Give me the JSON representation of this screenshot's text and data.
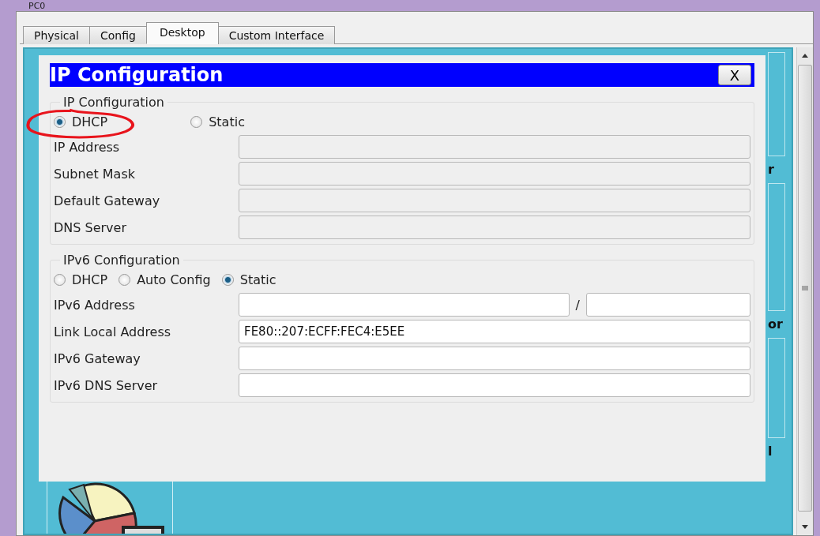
{
  "window": {
    "title": "PC0"
  },
  "tabs": [
    {
      "label": "Physical",
      "selected": false
    },
    {
      "label": "Config",
      "selected": false
    },
    {
      "label": "Desktop",
      "selected": true
    },
    {
      "label": "Custom Interface",
      "selected": false
    }
  ],
  "desktop": {
    "label_fragments": [
      "r",
      "or",
      "l"
    ]
  },
  "dialog": {
    "title": "IP Configuration",
    "close": "X",
    "ipv4": {
      "legend": "IP Configuration",
      "modes": [
        {
          "label": "DHCP",
          "selected": true
        },
        {
          "label": "Static",
          "selected": false
        }
      ],
      "fields": [
        {
          "label": "IP Address",
          "disabled": true
        },
        {
          "label": "Subnet Mask",
          "disabled": true
        },
        {
          "label": "Default Gateway",
          "disabled": true
        },
        {
          "label": "DNS Server",
          "disabled": true
        }
      ]
    },
    "ipv6": {
      "legend": "IPv6 Configuration",
      "modes": [
        {
          "label": "DHCP",
          "selected": false
        },
        {
          "label": "Auto Config",
          "selected": false
        },
        {
          "label": "Static",
          "selected": true
        }
      ],
      "prefix_separator": "/",
      "fields": [
        {
          "label": "IPv6 Address",
          "disabled": false,
          "kind": "prefix"
        },
        {
          "label": "Link Local Address",
          "value": "FE80::207:ECFF:FEC4:E5EE",
          "disabled": false,
          "kind": "plain"
        },
        {
          "label": "IPv6 Gateway",
          "disabled": false,
          "kind": "plain"
        },
        {
          "label": "IPv6 DNS Server",
          "disabled": false,
          "kind": "plain"
        }
      ]
    }
  }
}
